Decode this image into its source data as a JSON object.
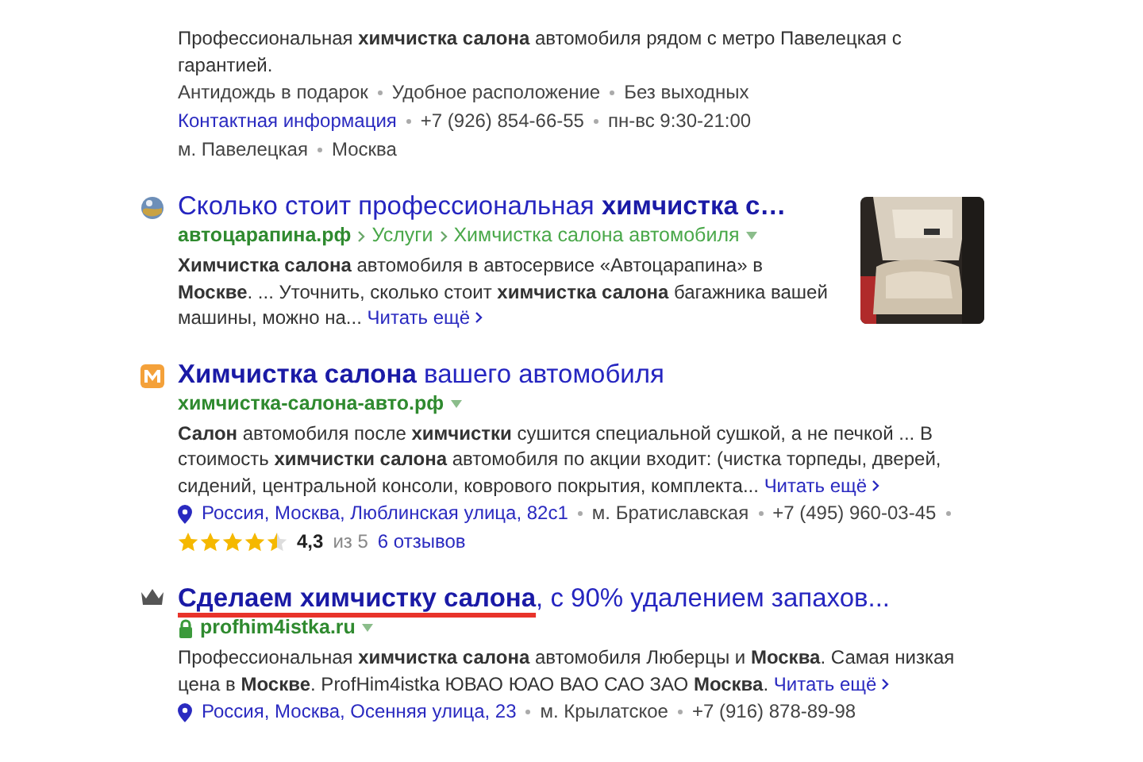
{
  "results": [
    {
      "kind": "none",
      "snippet": "Профессиональная **химчистка салона** автомобиля рядом с метро Павелецкая с гарантией.",
      "info_lines": [
        [
          {
            "text": "Антидождь в подарок",
            "kind": "text"
          },
          {
            "text": "Удобное расположение",
            "kind": "text"
          },
          {
            "text": "Без выходных",
            "kind": "text"
          }
        ],
        [
          {
            "text": "Контактная информация",
            "kind": "link"
          },
          {
            "text": "+7 (926) 854-66-55",
            "kind": "text"
          },
          {
            "text": "пн-вс 9:30-21:00",
            "kind": "text"
          }
        ],
        [
          {
            "text": "м. Павелецкая",
            "kind": "text"
          },
          {
            "text": "Москва",
            "kind": "text"
          }
        ]
      ]
    },
    {
      "kind": "globe",
      "title": "Сколько стоит профессиональная **химчистка с…**",
      "url": {
        "domain": "автоцарапина.рф",
        "path": [
          "Услуги",
          "Химчистка салона автомобиля"
        ]
      },
      "snippet": "**Химчистка салона** автомобиля в автосервисе «Автоцарапина» в **Москве**. ... Уточнить, сколько стоит **химчистка салона** багажника вашей машины, можно на...",
      "more": "Читать ещё",
      "thumbnail": true
    },
    {
      "kind": "metro",
      "title": "**Химчистка салона** вашего автомобиля",
      "url": {
        "domain": "химчистка-салона-авто.рф"
      },
      "snippet": "**Салон** автомобиля после **химчистки** сушится специальной сушкой, а не печкой ... В стоимость **химчистки салона** автомобиля по акции входит: (чистка торпеды, дверей, сидений, центральной консоли, коврового покрытия, комплекта...",
      "more": "Читать ещё",
      "address": {
        "place": "Россия, Москва, Люблинская улица, 82с1",
        "items": [
          "м. Братиславская",
          "+7 (495) 960-03-45"
        ],
        "trailing_dot": true
      },
      "rating": {
        "stars": 4.5,
        "score": "4,3",
        "scale": "из 5",
        "reviews": "6 отзывов"
      }
    },
    {
      "kind": "crown",
      "title": "**Сделаем химчистку салона**, с 90% удалением запахов...",
      "highlighted": true,
      "url": {
        "lock": true,
        "domain": "profhim4istka.ru"
      },
      "snippet": "Профессиональная **химчистка салона** автомобиля Люберцы и **Москва**. Самая низкая цена в **Москве**. ProfHim4istka ЮВАО ЮАО ВАО САО ЗАО **Москва**.",
      "more": "Читать ещё",
      "address": {
        "place": "Россия, Москва, Осенняя улица, 23",
        "items": [
          "м. Крылатское",
          "+7 (916) 878-89-98"
        ]
      }
    }
  ]
}
